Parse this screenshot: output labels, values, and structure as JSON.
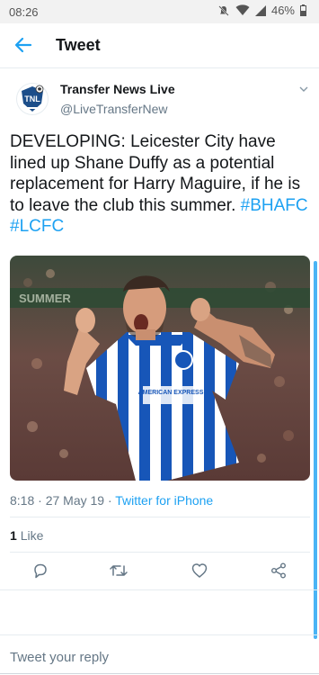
{
  "status_bar": {
    "time": "08:26",
    "battery": "46%"
  },
  "header": {
    "title": "Tweet"
  },
  "author": {
    "name": "Transfer News Live",
    "handle": "@LiveTransferNew"
  },
  "tweet": {
    "text": "DEVELOPING: Leicester City have lined up Shane Duffy as a potential replacement for Harry Maguire, if he is to leave the club this summer.",
    "hashtags": [
      "#BHAFC",
      "#LCFC"
    ]
  },
  "media": {
    "stadium_banner": "SUMMER",
    "sponsor_text": "AMERICAN EXPRESS"
  },
  "meta": {
    "time": "8:18",
    "date": "27 May 19",
    "source": "Twitter for iPhone"
  },
  "engagement": {
    "likes_count": "1",
    "likes_label": "Like"
  },
  "reply": {
    "placeholder": "Tweet your reply"
  },
  "colors": {
    "accent": "#1da1f2",
    "secondary_text": "#657786"
  }
}
